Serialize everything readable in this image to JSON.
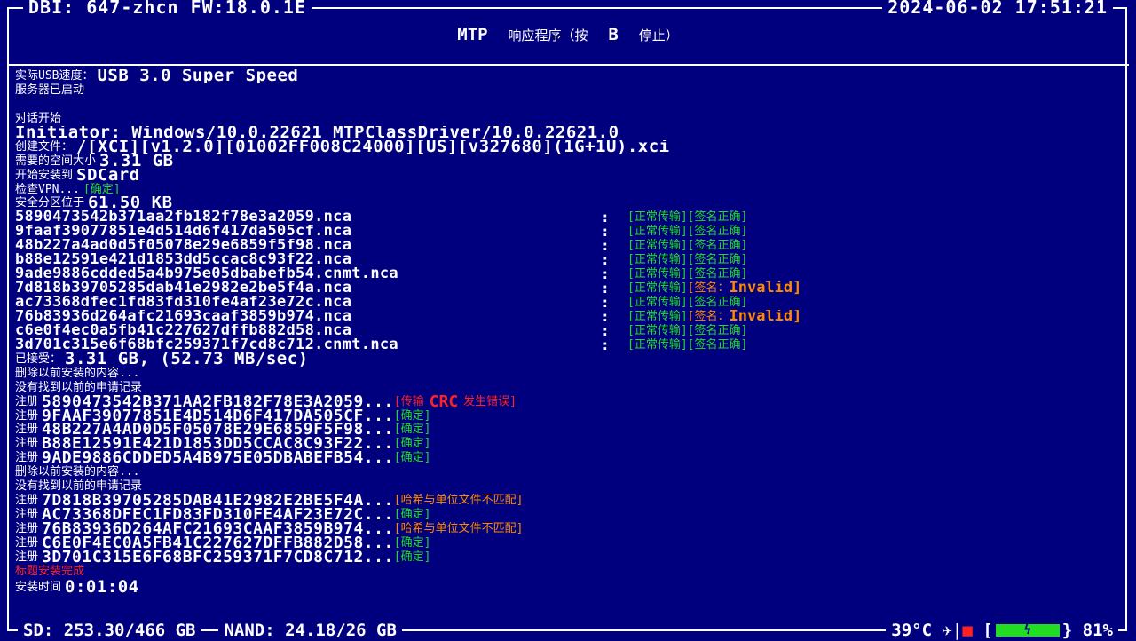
{
  "header": {
    "left": "DBI: 647-zhcn FW:18.0.1E",
    "right": "2024-06-02 17:51:21"
  },
  "title": {
    "mtp": "MTP",
    "msg_a": "响应程序（按",
    "key": "B",
    "msg_b": "停止）"
  },
  "log": {
    "usb_speed_label": "实际USB速度：",
    "usb_speed_value": "USB 3.0 Super Speed",
    "server_started": "服务器已启动",
    "session_start": "对话开始",
    "initiator": "Initiator: Windows/10.0.22621 MTPClassDriver/10.0.22621.0",
    "create_file_label": "创建文件：",
    "create_file_value": "/[XCI][v1.2.0][01002FF008C24000][US][v327680](1G+1U).xci",
    "space_label": "需要的空间大小",
    "space_value": "3.31 GB",
    "install_to_label": "开始安装到",
    "install_to_value": "SDCard",
    "vpn_label": "检查VPN...",
    "vpn_status": "[确定]",
    "safe_label": "安全分区位于",
    "safe_value": "61.50 KB",
    "nca_files": [
      {
        "name": "5890473542b371aa2fb182f78e3a2059.nca",
        "transfer": "[正常传输]",
        "sig": "[签名正确]",
        "invalid": false
      },
      {
        "name": "9faaf39077851e4d514d6f417da505cf.nca",
        "transfer": "[正常传输]",
        "sig": "[签名正确]",
        "invalid": false
      },
      {
        "name": "48b227a4ad0d5f05078e29e6859f5f98.nca",
        "transfer": "[正常传输]",
        "sig": "[签名正确]",
        "invalid": false
      },
      {
        "name": "b88e12591e421d1853dd5ccac8c93f22.nca",
        "transfer": "[正常传输]",
        "sig": "[签名正确]",
        "invalid": false
      },
      {
        "name": "9ade9886cdded5a4b975e05dbabefb54.cnmt.nca",
        "transfer": "[正常传输]",
        "sig": "[签名正确]",
        "invalid": false
      },
      {
        "name": "7d818b39705285dab41e2982e2be5f4a.nca",
        "transfer": "[正常传输]",
        "sig": "[签名：",
        "sig_tail": "Invalid]",
        "invalid": true
      },
      {
        "name": "ac73368dfec1fd83fd310fe4af23e72c.nca",
        "transfer": "[正常传输]",
        "sig": "[签名正确]",
        "invalid": false
      },
      {
        "name": "76b83936d264afc21693caaf3859b974.nca",
        "transfer": "[正常传输]",
        "sig": "[签名：",
        "sig_tail": "Invalid]",
        "invalid": true
      },
      {
        "name": "c6e0f4ec0a5fb41c227627dffb882d58.nca",
        "transfer": "[正常传输]",
        "sig": "[签名正确]",
        "invalid": false
      },
      {
        "name": "3d701c315e6f68bfc259371f7cd8c712.cnmt.nca",
        "transfer": "[正常传输]",
        "sig": "[签名正确]",
        "invalid": false
      }
    ],
    "received_label": "已接受：",
    "received_value": "3.31 GB, (52.73 MB/sec)",
    "delete_prev_1": "删除以前安装的内容...",
    "no_prev_1": "没有找到以前的申请记录",
    "register_label": "注册",
    "register_1": [
      {
        "id": "5890473542B371AA2FB182F78E3A2059...",
        "status_a": "[传输",
        "status_crc": "CRC",
        "status_b": "发生错误]",
        "type": "crc"
      },
      {
        "id": "9FAAF39077851E4D514D6F417DA505CF...",
        "status": "[确定]",
        "type": "ok"
      },
      {
        "id": "48B227A4AD0D5F05078E29E6859F5F98...",
        "status": "[确定]",
        "type": "ok"
      },
      {
        "id": "B88E12591E421D1853DD5CCAC8C93F22...",
        "status": "[确定]",
        "type": "ok"
      },
      {
        "id": "9ADE9886CDDED5A4B975E05DBABEFB54...",
        "status": "[确定]",
        "type": "ok"
      }
    ],
    "delete_prev_2": "删除以前安装的内容...",
    "no_prev_2": "没有找到以前的申请记录",
    "register_2": [
      {
        "id": "7D818B39705285DAB41E2982E2BE5F4A...",
        "status": "[哈希与单位文件不匹配]",
        "type": "mismatch"
      },
      {
        "id": "AC73368DFEC1FD83FD310FE4AF23E72C...",
        "status": "[确定]",
        "type": "ok"
      },
      {
        "id": "76B83936D264AFC21693CAAF3859B974...",
        "status": "[哈希与单位文件不匹配]",
        "type": "mismatch"
      },
      {
        "id": "C6E0F4EC0A5FB41C227627DFFB882D58...",
        "status": "[确定]",
        "type": "ok"
      },
      {
        "id": "3D701C315E6F68BFC259371F7CD8C712...",
        "status": "[确定]",
        "type": "ok"
      }
    ],
    "install_done": "标题安装完成",
    "install_time_label": "安装时间",
    "install_time_value": "0:01:04"
  },
  "footer": {
    "sd": "SD: 253.30/466 GB",
    "nand": "NAND: 24.18/26 GB",
    "temp": "39°C",
    "airplane_icon": "✈",
    "lock_icon": "🔒",
    "battery_open": "[",
    "battery_glyph": "ϟ",
    "battery_close": "}",
    "battery_level": 0.81,
    "battery_pct": "81%"
  },
  "colors": {
    "background": "#00007f",
    "ok": "#22dd22",
    "warn": "#ff8800",
    "error": "#ff2222"
  }
}
